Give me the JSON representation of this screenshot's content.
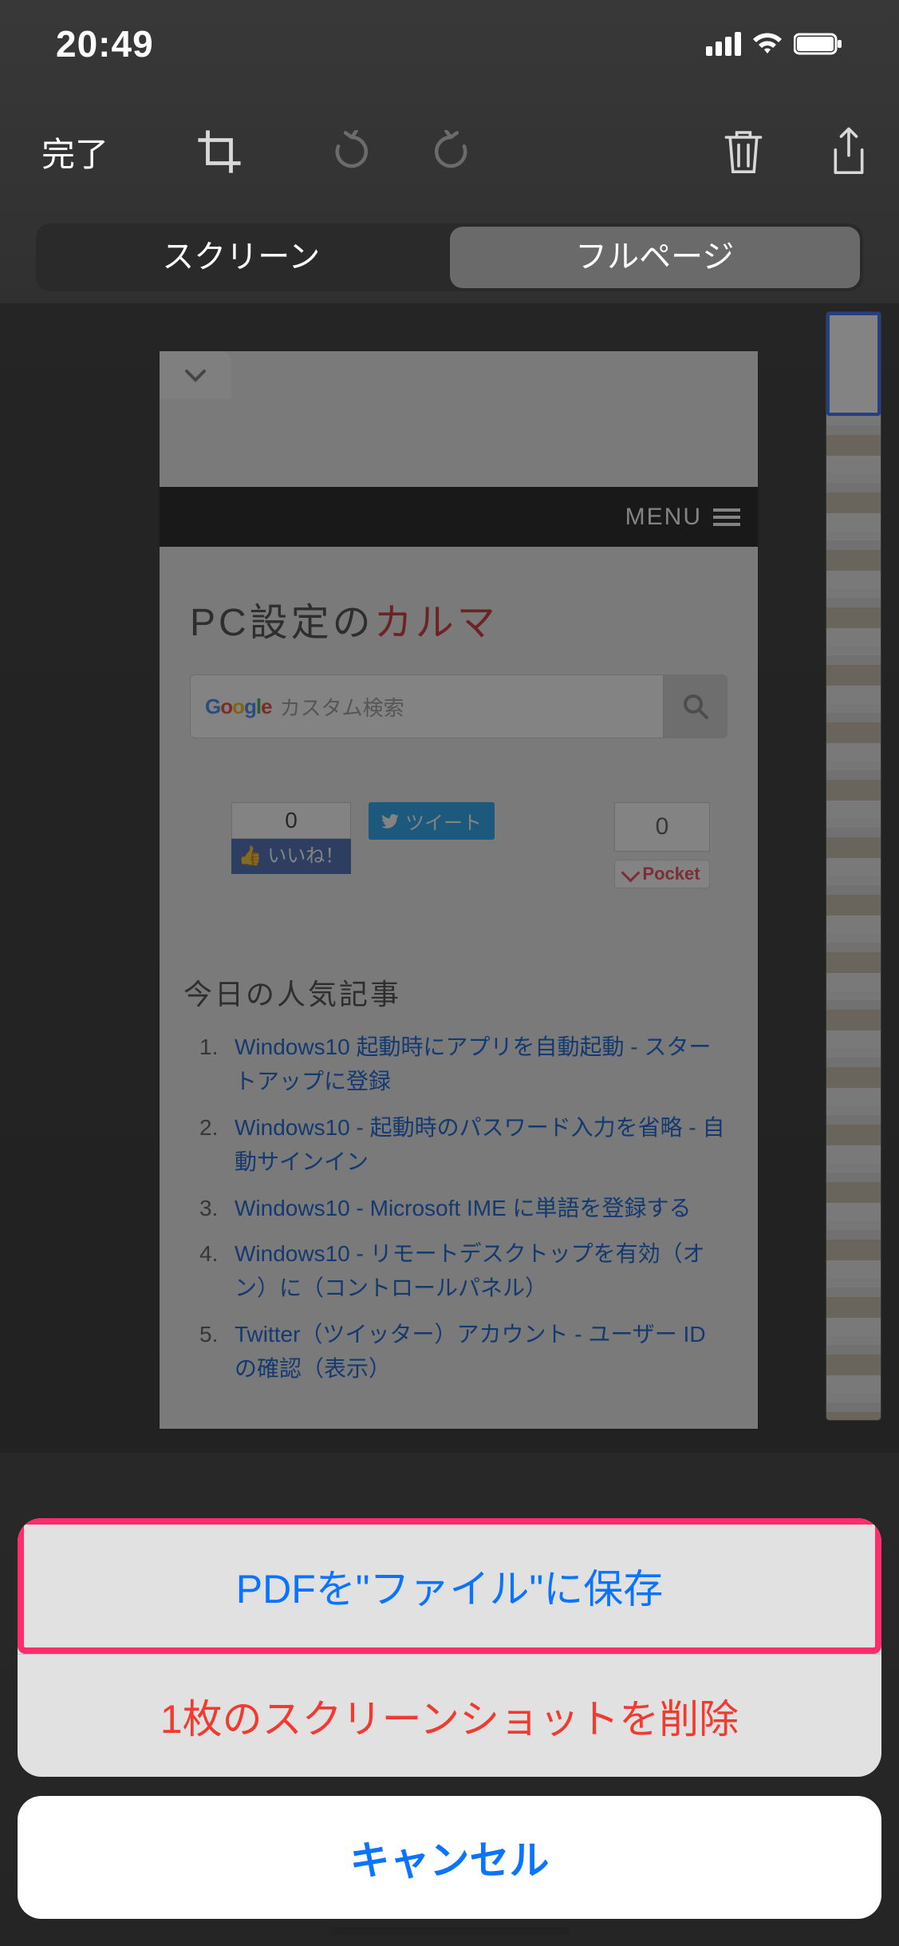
{
  "status": {
    "time": "20:49"
  },
  "toolbar": {
    "done": "完了"
  },
  "segmented": {
    "screen": "スクリーン",
    "fullpage": "フルページ"
  },
  "page": {
    "menu": "MENU",
    "title_prefix": "PC設定の",
    "title_accent": "カルマ",
    "search_placeholder": "カスタム検索",
    "fb_count": "0",
    "fb_like": "いいね！",
    "tweet": "ツイート",
    "pocket_count": "0",
    "pocket_label": "Pocket",
    "popular_heading": "今日の人気記事",
    "links": [
      "Windows10 起動時にアプリを自動起動 - スタートアップに登録",
      "Windows10 - 起動時のパスワード入力を省略 - 自動サインイン",
      "Windows10 - Microsoft IME に単語を登録する",
      "Windows10 - リモートデスクトップを有効（オン）に（コントロールパネル）",
      "Twitter（ツイッター）アカウント - ユーザー ID の確認（表示）"
    ]
  },
  "sheet": {
    "save_pdf": "PDFを\"ファイル\"に保存",
    "delete": "1枚のスクリーンショットを削除",
    "cancel": "キャンセル"
  }
}
